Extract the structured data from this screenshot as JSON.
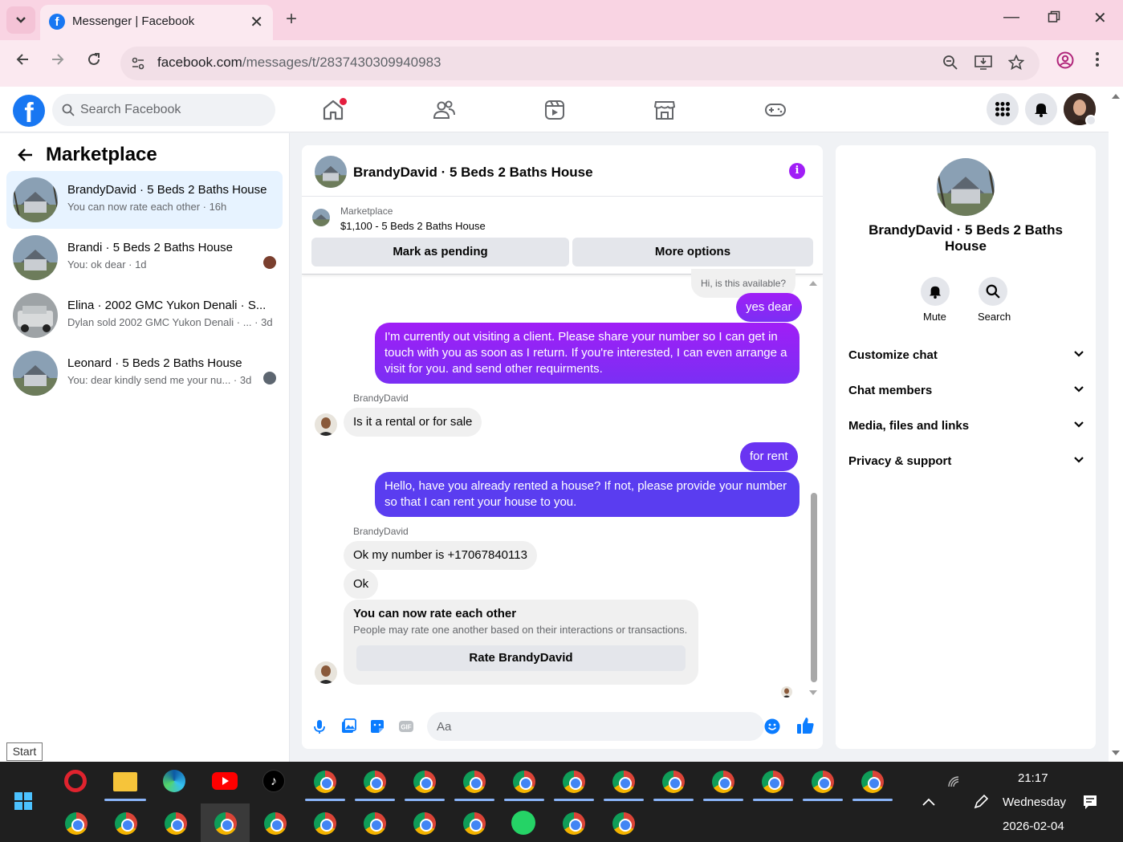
{
  "browser": {
    "tab_title": "Messenger | Facebook",
    "url_host": "facebook.com",
    "url_path": "/messages/t/2837430309940983"
  },
  "fb": {
    "search_placeholder": "Search Facebook"
  },
  "left": {
    "title": "Marketplace",
    "conversations": [
      {
        "name": "BrandyDavid · 5 Beds 2 Baths House",
        "sub": "You can now rate each other · 16h"
      },
      {
        "name": "Brandi · 5 Beds 2 Baths House",
        "sub": "You: ok dear · 1d"
      },
      {
        "name": "Elina · 2002 GMC Yukon Denali · S...",
        "sub": "Dylan sold 2002 GMC Yukon Denali · ...  · 3d"
      },
      {
        "name": "Leonard · 5 Beds 2 Baths House",
        "sub": "You: dear kindly send me your nu...  · 3d"
      }
    ]
  },
  "chat": {
    "header_title": "BrandyDavid · 5 Beds 2 Baths House",
    "marketplace_label": "Marketplace",
    "listing": "$1,100 - 5 Beds 2 Baths House",
    "mark_pending": "Mark as pending",
    "more_options": "More options",
    "messages": {
      "m0": "Hi, is this available?",
      "m1": "yes dear",
      "m2": "I'm currently out visiting a client. Please share your number so I can get in touch with you as soon as I return. If you're interested, I can even arrange a visit for you. and send other requirments.",
      "sender1": "BrandyDavid",
      "m3": "Is it a rental or for sale",
      "m4": "for rent",
      "m5": "Hello, have you already rented a house? If not, please provide your number so that I can rent your house to you.",
      "sender2": "BrandyDavid",
      "m6": "Ok my number is +17067840113",
      "m7": "Ok"
    },
    "rate_title": "You can now rate each other",
    "rate_sub": "People may rate one another based on their interactions or transactions.",
    "rate_button": "Rate BrandyDavid",
    "composer_placeholder": "Aa"
  },
  "right": {
    "name": "BrandyDavid · 5 Beds 2 Baths House",
    "mute": "Mute",
    "search": "Search",
    "sections": [
      "Customize chat",
      "Chat members",
      "Media, files and links",
      "Privacy & support"
    ]
  },
  "taskbar": {
    "start_tooltip": "Start",
    "time": "21:17",
    "day": "Wednesday",
    "date": "2026-02-04"
  }
}
